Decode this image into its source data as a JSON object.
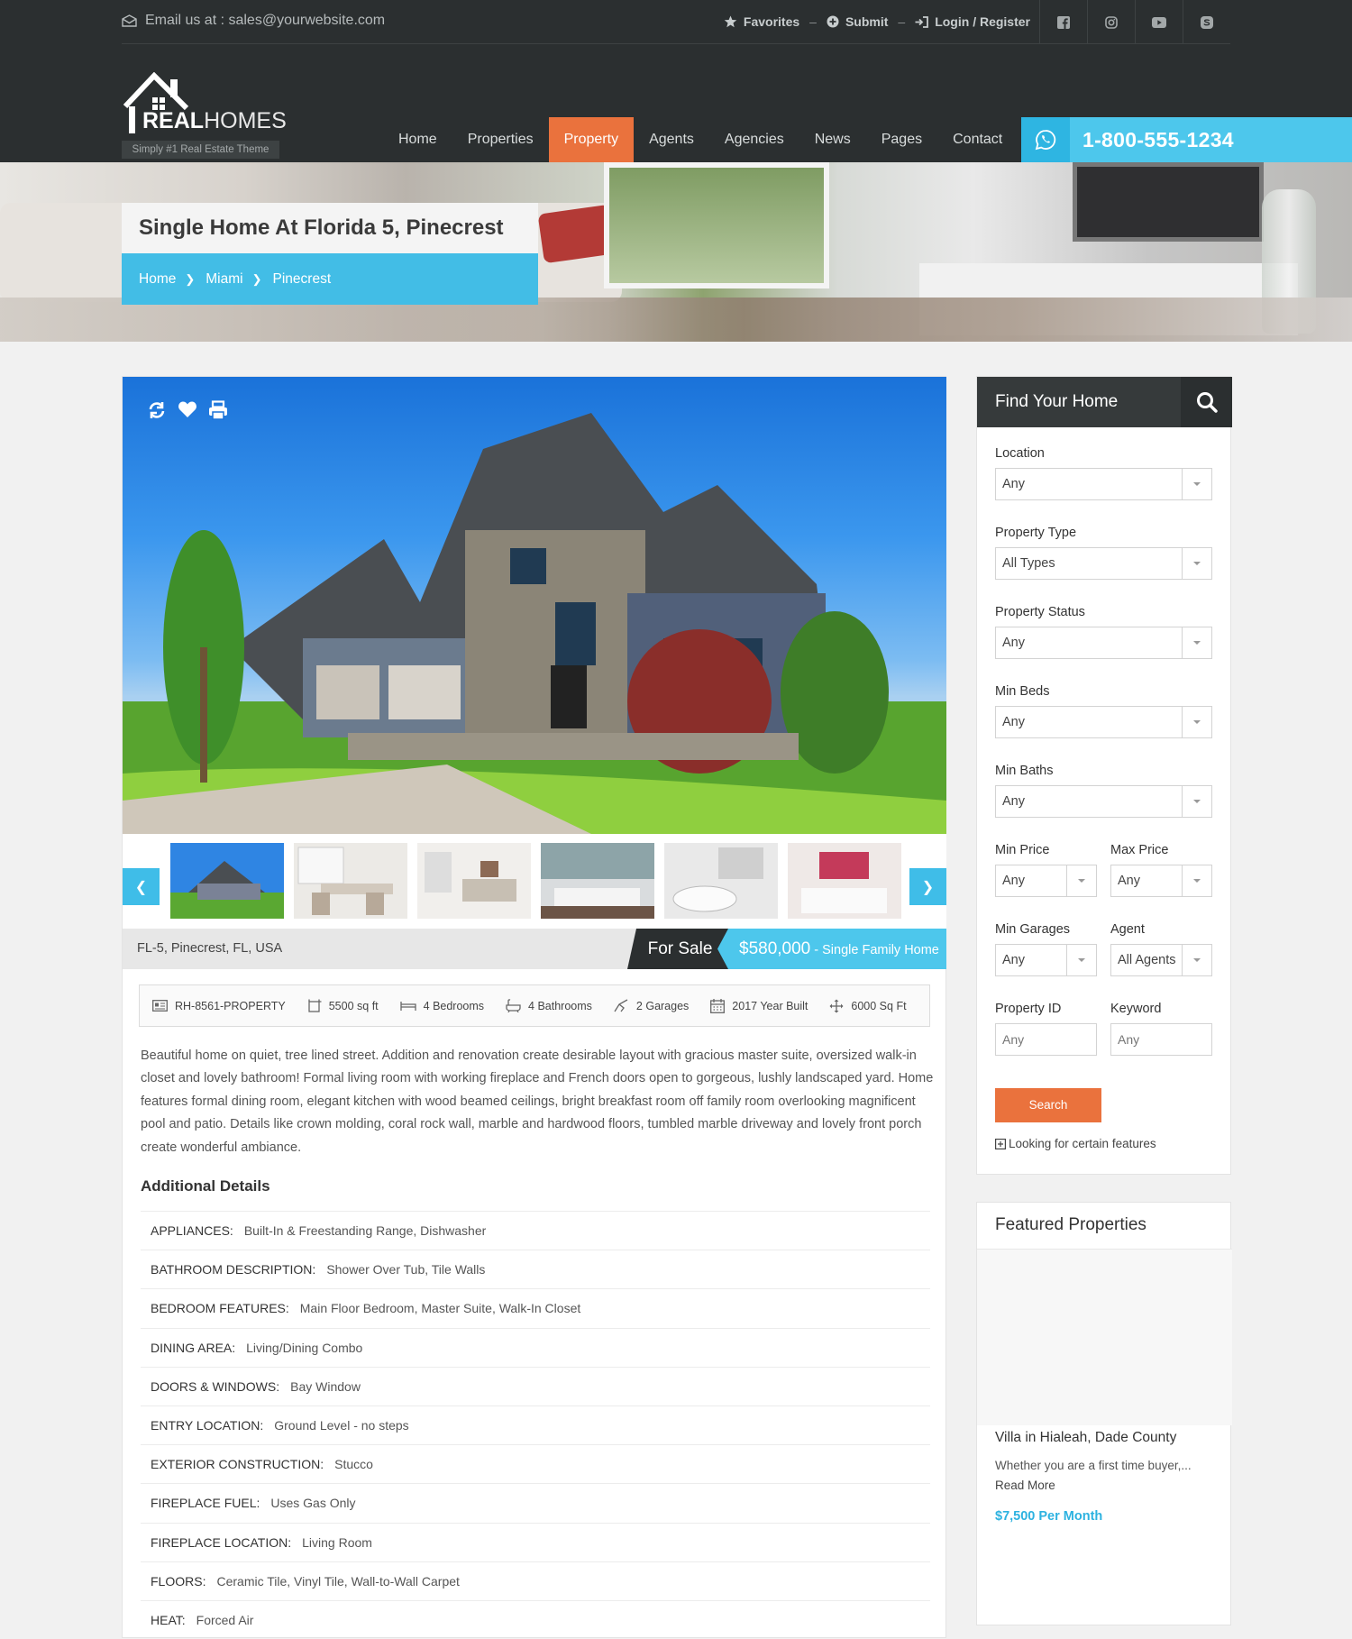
{
  "topbar": {
    "email_text": "Email us at : sales@yourwebsite.com",
    "favorites": "Favorites",
    "submit": "Submit",
    "login": "Login / Register",
    "socials": [
      "facebook-icon",
      "instagram-icon",
      "youtube-icon",
      "skype-icon"
    ]
  },
  "logo": {
    "bold": "REAL",
    "light": "HOMES",
    "tagline": "Simply #1 Real Estate Theme"
  },
  "nav": {
    "items": [
      "Home",
      "Properties",
      "Property",
      "Agents",
      "Agencies",
      "News",
      "Pages",
      "Contact"
    ],
    "active": "Property"
  },
  "phone": "1-800-555-1234",
  "banner": {
    "title": "Single Home At Florida 5, Pinecrest",
    "breadcrumb": [
      "Home",
      "Miami",
      "Pinecrest"
    ]
  },
  "property": {
    "address": "FL-5, Pinecrest, FL, USA",
    "status": "For Sale",
    "price": "$580,000",
    "type_suffix": " - Single Family Home",
    "meta": [
      {
        "icon": "id-card-icon",
        "text": "RH-8561-PROPERTY"
      },
      {
        "icon": "area-icon",
        "text": "5500 sq ft"
      },
      {
        "icon": "bed-icon",
        "text": "4 Bedrooms"
      },
      {
        "icon": "bath-icon",
        "text": "4 Bathrooms"
      },
      {
        "icon": "garage-icon",
        "text": "2 Garages"
      },
      {
        "icon": "calendar-icon",
        "text": "2017 Year Built"
      },
      {
        "icon": "lot-size-icon",
        "text": "6000 Sq Ft"
      }
    ],
    "description": "Beautiful home on quiet, tree lined street. Addition and renovation create desirable layout with gracious master suite, oversized walk-in closet and lovely bathroom! Formal living room with working fireplace and French doors open to gorgeous, lushly landscaped yard. Home features formal dining room, elegant kitchen with wood beamed ceilings, bright breakfast room off family room overlooking magnificent pool and patio. Details like crown molding, coral rock wall, marble and hardwood floors, tumbled marble driveway and lovely front porch create wonderful ambiance.",
    "additional_title": "Additional Details",
    "details": [
      {
        "k": "APPLIANCES:",
        "v": "Built-In & Freestanding Range, Dishwasher"
      },
      {
        "k": "BATHROOM DESCRIPTION:",
        "v": "Shower Over Tub, Tile Walls"
      },
      {
        "k": "BEDROOM FEATURES:",
        "v": "Main Floor Bedroom, Master Suite, Walk-In Closet"
      },
      {
        "k": "DINING AREA:",
        "v": "Living/Dining Combo"
      },
      {
        "k": "DOORS & WINDOWS:",
        "v": "Bay Window"
      },
      {
        "k": "ENTRY LOCATION:",
        "v": "Ground Level - no steps"
      },
      {
        "k": "EXTERIOR CONSTRUCTION:",
        "v": "Stucco"
      },
      {
        "k": "FIREPLACE FUEL:",
        "v": "Uses Gas Only"
      },
      {
        "k": "FIREPLACE LOCATION:",
        "v": "Living Room"
      },
      {
        "k": "FLOORS:",
        "v": "Ceramic Tile, Vinyl Tile, Wall-to-Wall Carpet"
      },
      {
        "k": "HEAT:",
        "v": "Forced Air"
      }
    ]
  },
  "search": {
    "title": "Find Your Home",
    "location_label": "Location",
    "location_value": "Any",
    "type_label": "Property Type",
    "type_value": "All Types",
    "status_label": "Property Status",
    "status_value": "Any",
    "beds_label": "Min Beds",
    "beds_value": "Any",
    "baths_label": "Min Baths",
    "baths_value": "Any",
    "min_price_label": "Min Price",
    "min_price_value": "Any",
    "max_price_label": "Max Price",
    "max_price_value": "Any",
    "garages_label": "Min Garages",
    "garages_value": "Any",
    "agent_label": "Agent",
    "agent_value": "All Agents",
    "id_label": "Property ID",
    "id_placeholder": "Any",
    "keyword_label": "Keyword",
    "keyword_placeholder": "Any",
    "button": "Search",
    "features_link": "Looking for certain features"
  },
  "featured": {
    "title": "Featured Properties",
    "item_title": "Villa in Hialeah, Dade County",
    "item_desc": "Whether you are a first time buyer,...",
    "read_more": "Read More",
    "item_price": "$7,500 Per Month"
  },
  "colors": {
    "accent_orange": "#ea723d",
    "accent_blue": "#4dc7ec",
    "dark": "#2b2f30"
  }
}
